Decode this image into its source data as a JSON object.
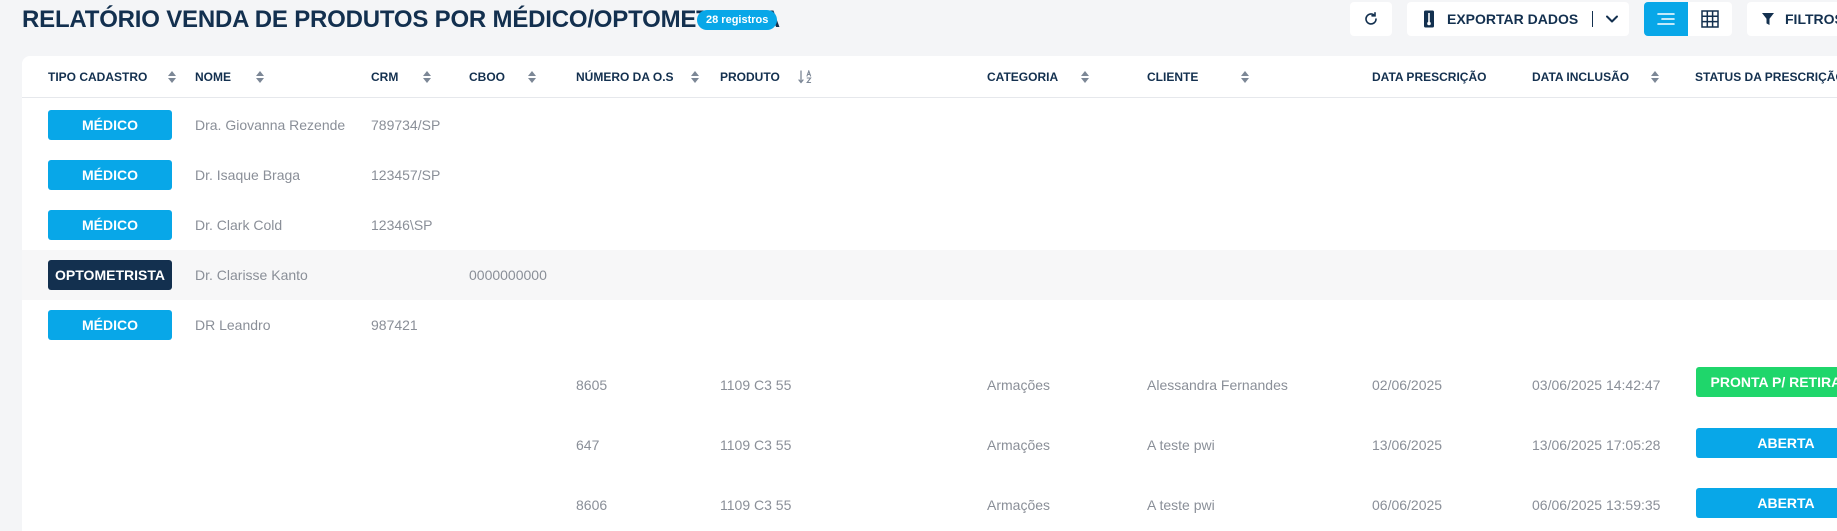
{
  "header": {
    "title": "RELATÓRIO VENDA DE PRODUTOS POR MÉDICO/OPTOMETRISTA",
    "records_badge": "28 registros",
    "export_label": "EXPORTAR DADOS",
    "filters_label": "FILTROS"
  },
  "columns": {
    "tipo_cadastro": "TIPO CADASTRO",
    "nome": "NOME",
    "crm": "CRM",
    "cboo": "CBOO",
    "numero_os": "NÚMERO DA O.S",
    "produto": "PRODUTO",
    "categoria": "CATEGORIA",
    "cliente": "CLIENTE",
    "data_prescricao": "DATA PRESCRIÇÃO",
    "data_inclusao": "DATA INCLUSÃO",
    "status": "STATUS DA PRESCRIÇÃO"
  },
  "professionals": [
    {
      "tipo": "MÉDICO",
      "nome": "Dra. Giovanna Rezende",
      "crm": "789734/SP",
      "cboo": ""
    },
    {
      "tipo": "MÉDICO",
      "nome": "Dr. Isaque Braga",
      "crm": "123457/SP",
      "cboo": ""
    },
    {
      "tipo": "MÉDICO",
      "nome": "Dr. Clark Cold",
      "crm": "12346\\SP",
      "cboo": ""
    },
    {
      "tipo": "OPTOMETRISTA",
      "nome": "Dr. Clarisse Kanto",
      "crm": "",
      "cboo": "0000000000"
    },
    {
      "tipo": "MÉDICO",
      "nome": "DR Leandro",
      "crm": "987421",
      "cboo": ""
    }
  ],
  "orders": [
    {
      "os": "8605",
      "produto": "1109 C3 55",
      "categoria": "Armações",
      "cliente": "Alessandra Fernandes",
      "data_prescricao": "02/06/2025",
      "data_inclusao": "03/06/2025 14:42:47",
      "status": "PRONTA P/ RETIRADA"
    },
    {
      "os": "647",
      "produto": "1109 C3 55",
      "categoria": "Armações",
      "cliente": "A teste pwi",
      "data_prescricao": "13/06/2025",
      "data_inclusao": "13/06/2025 17:05:28",
      "status": "ABERTA"
    },
    {
      "os": "8606",
      "produto": "1109 C3 55",
      "categoria": "Armações",
      "cliente": "A teste pwi",
      "data_prescricao": "06/06/2025",
      "data_inclusao": "06/06/2025 13:59:35",
      "status": "ABERTA"
    }
  ],
  "colors": {
    "accent": "#08a7e8",
    "navy": "#13304f",
    "success": "#1fd66b"
  },
  "icons": {
    "refresh": "refresh-icon",
    "export": "thermometer-icon",
    "chevron": "chevron-down-icon",
    "list_view": "list-view-icon",
    "grid_view": "grid-view-icon",
    "filter": "filter-icon",
    "sort": "sort-icon",
    "sort_az": "sort-alpha-icon"
  }
}
